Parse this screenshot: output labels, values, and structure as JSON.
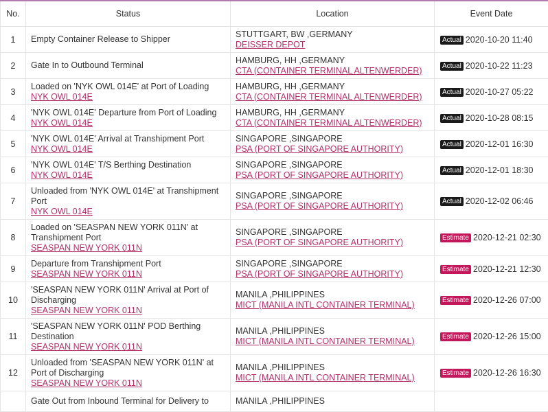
{
  "header": {
    "no": "No.",
    "status": "Status",
    "location": "Location",
    "event_date": "Event Date"
  },
  "rows": [
    {
      "no": "1",
      "status": "Empty Container Release to Shipper",
      "vessel": "",
      "city": "STUTTGART, BW ,GERMANY",
      "facility": "DEISSER DEPOT",
      "badge": "Actual",
      "date": "2020-10-20 11:40"
    },
    {
      "no": "2",
      "status": "Gate In to Outbound Terminal",
      "vessel": "",
      "city": "HAMBURG, HH ,GERMANY",
      "facility": "CTA (CONTAINER TERMINAL ALTENWERDER)",
      "badge": "Actual",
      "date": "2020-10-22 11:23"
    },
    {
      "no": "3",
      "status": "Loaded on 'NYK OWL 014E' at Port of Loading",
      "vessel": "NYK OWL 014E",
      "city": "HAMBURG, HH ,GERMANY",
      "facility": "CTA (CONTAINER TERMINAL ALTENWERDER)",
      "badge": "Actual",
      "date": "2020-10-27 05:22"
    },
    {
      "no": "4",
      "status": "'NYK OWL 014E' Departure from Port of Loading",
      "vessel": "NYK OWL 014E",
      "city": "HAMBURG, HH ,GERMANY",
      "facility": "CTA (CONTAINER TERMINAL ALTENWERDER)",
      "badge": "Actual",
      "date": "2020-10-28 08:15"
    },
    {
      "no": "5",
      "status": "'NYK OWL 014E' Arrival at Transhipment Port",
      "vessel": "NYK OWL 014E",
      "city": "SINGAPORE ,SINGAPORE",
      "facility": "PSA (PORT OF SINGAPORE AUTHORITY)",
      "badge": "Actual",
      "date": "2020-12-01 16:30"
    },
    {
      "no": "6",
      "status": "'NYK OWL 014E' T/S Berthing Destination",
      "vessel": "NYK OWL 014E",
      "city": "SINGAPORE ,SINGAPORE",
      "facility": "PSA (PORT OF SINGAPORE AUTHORITY)",
      "badge": "Actual",
      "date": "2020-12-01 18:30"
    },
    {
      "no": "7",
      "status": "Unloaded from 'NYK OWL 014E' at Transhipment Port",
      "vessel": "NYK OWL 014E",
      "city": "SINGAPORE ,SINGAPORE",
      "facility": "PSA (PORT OF SINGAPORE AUTHORITY)",
      "badge": "Actual",
      "date": "2020-12-02 06:46"
    },
    {
      "no": "8",
      "status": "Loaded on 'SEASPAN NEW YORK 011N' at Transhipment Port",
      "vessel": "SEASPAN NEW YORK 011N",
      "city": "SINGAPORE ,SINGAPORE",
      "facility": "PSA (PORT OF SINGAPORE AUTHORITY)",
      "badge": "Estimate",
      "date": "2020-12-21 02:30"
    },
    {
      "no": "9",
      "status": "Departure from Transhipment Port",
      "vessel": "SEASPAN NEW YORK 011N",
      "city": "SINGAPORE ,SINGAPORE",
      "facility": "PSA (PORT OF SINGAPORE AUTHORITY)",
      "badge": "Estimate",
      "date": "2020-12-21 12:30"
    },
    {
      "no": "10",
      "status": "'SEASPAN NEW YORK 011N' Arrival at Port of Discharging",
      "vessel": "SEASPAN NEW YORK 011N",
      "city": "MANILA ,PHILIPPINES",
      "facility": "MICT (MANILA INTL CONTAINER TERMINAL)",
      "badge": "Estimate",
      "date": "2020-12-26 07:00"
    },
    {
      "no": "11",
      "status": "'SEASPAN NEW YORK 011N' POD Berthing Destination",
      "vessel": "SEASPAN NEW YORK 011N",
      "city": "MANILA ,PHILIPPINES",
      "facility": "MICT (MANILA INTL CONTAINER TERMINAL)",
      "badge": "Estimate",
      "date": "2020-12-26 15:00"
    },
    {
      "no": "12",
      "status": "Unloaded from 'SEASPAN NEW YORK 011N' at Port of Discharging",
      "vessel": "SEASPAN NEW YORK 011N",
      "city": "MANILA ,PHILIPPINES",
      "facility": "MICT (MANILA INTL CONTAINER TERMINAL)",
      "badge": "Estimate",
      "date": "2020-12-26 16:30"
    },
    {
      "no": "",
      "status": "Gate Out from Inbound Terminal for Delivery to",
      "vessel": "",
      "city": "MANILA ,PHILIPPINES",
      "facility": "",
      "badge": "",
      "date": ""
    }
  ],
  "colors": {
    "link": "#b0306a",
    "actual_badge": "#1a1a1a",
    "estimate_badge": "#c2185b",
    "header_accent": "#b07ab0"
  }
}
